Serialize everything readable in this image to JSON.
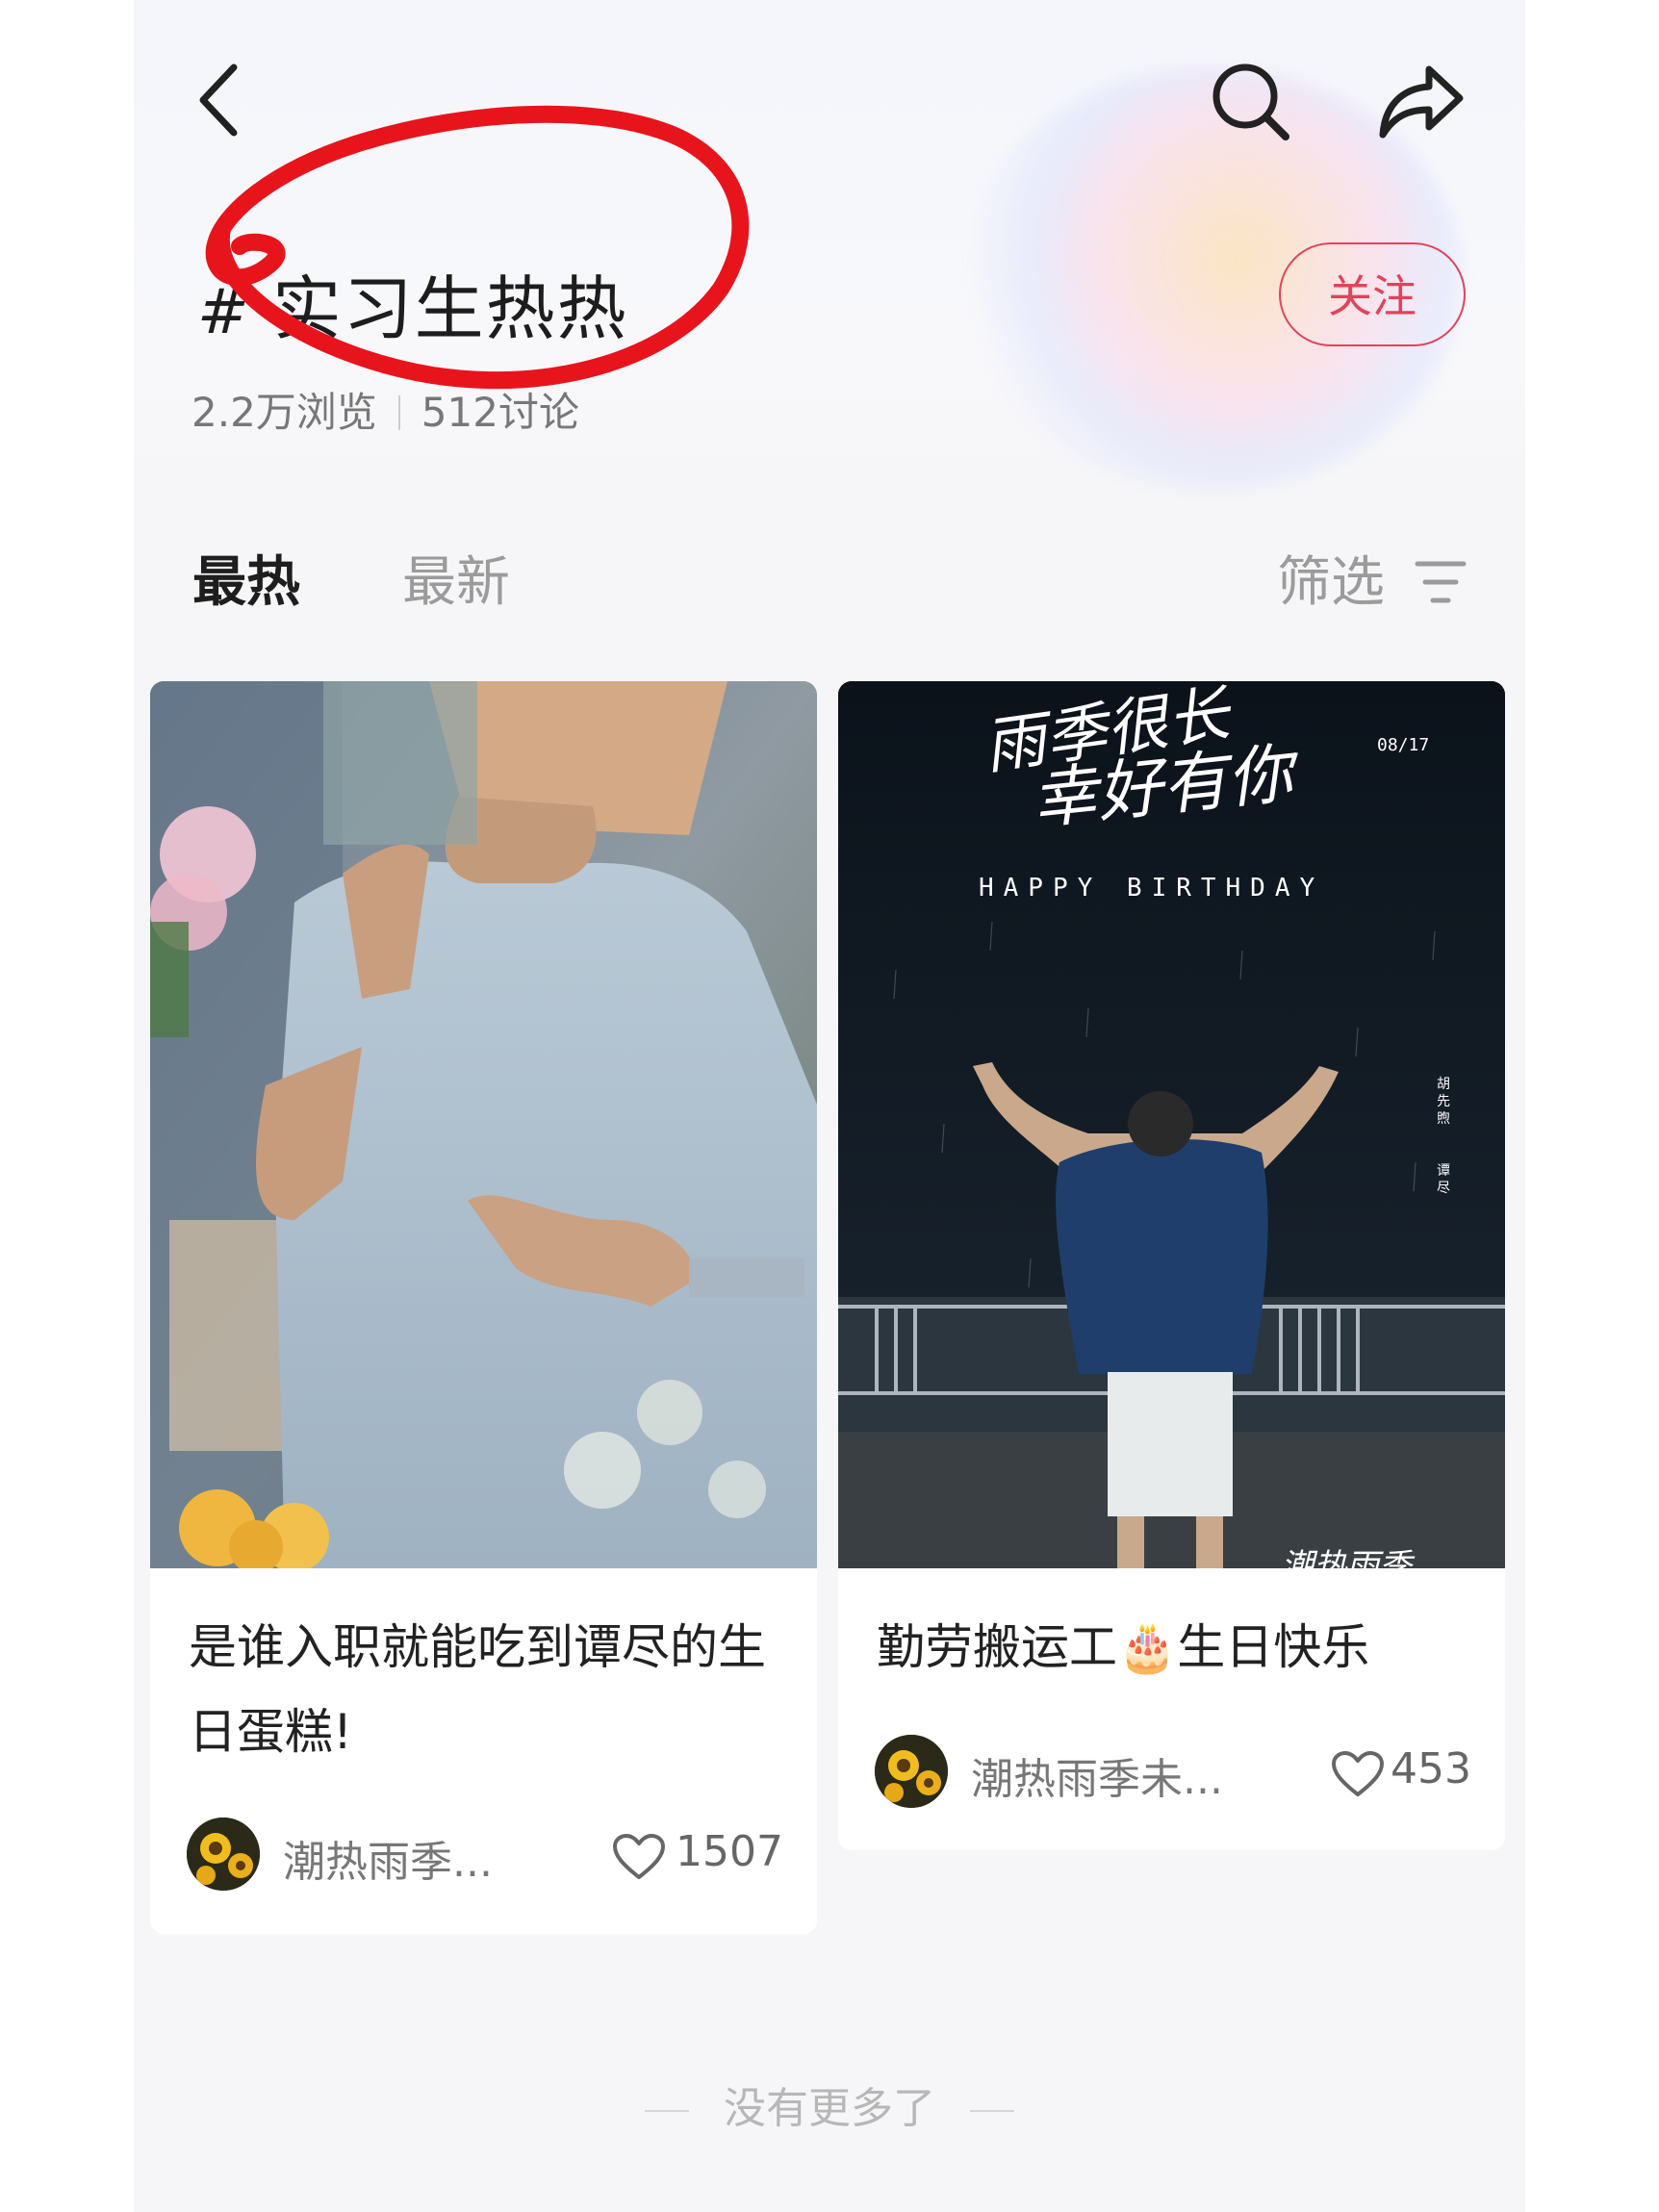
{
  "header": {
    "back_icon": "chevron-left-icon",
    "search_icon": "search-icon",
    "share_icon": "share-icon",
    "hash": "#",
    "topic_title": "实习生热热",
    "views": "2.2万浏览",
    "discussions": "512讨论",
    "follow_label": "关注",
    "accent_color": "#e0445a"
  },
  "tabs": {
    "hot_label": "最热",
    "new_label": "最新",
    "filter_label": "筛选",
    "filter_icon": "filter-lines-icon"
  },
  "posts": [
    {
      "title": "是谁入职就能吃到谭尽的生日蛋糕!",
      "author": "潮热雨季...",
      "likes": "1507",
      "heart_icon": "heart-outline-icon"
    },
    {
      "title": "勤劳搬运工🎂生日快乐",
      "author": "潮热雨季未...",
      "likes": "453",
      "heart_icon": "heart-outline-icon",
      "poster": {
        "script_line_1": "雨季很长",
        "script_line_2": "幸好有你",
        "date": "08/17",
        "happy_birthday": "HAPPY BIRTHDAY",
        "side_text_1": "胡先煦",
        "side_text_2": "谭尽",
        "signature": "潮热雨季"
      }
    }
  ],
  "footer": {
    "end_text": "没有更多了"
  }
}
